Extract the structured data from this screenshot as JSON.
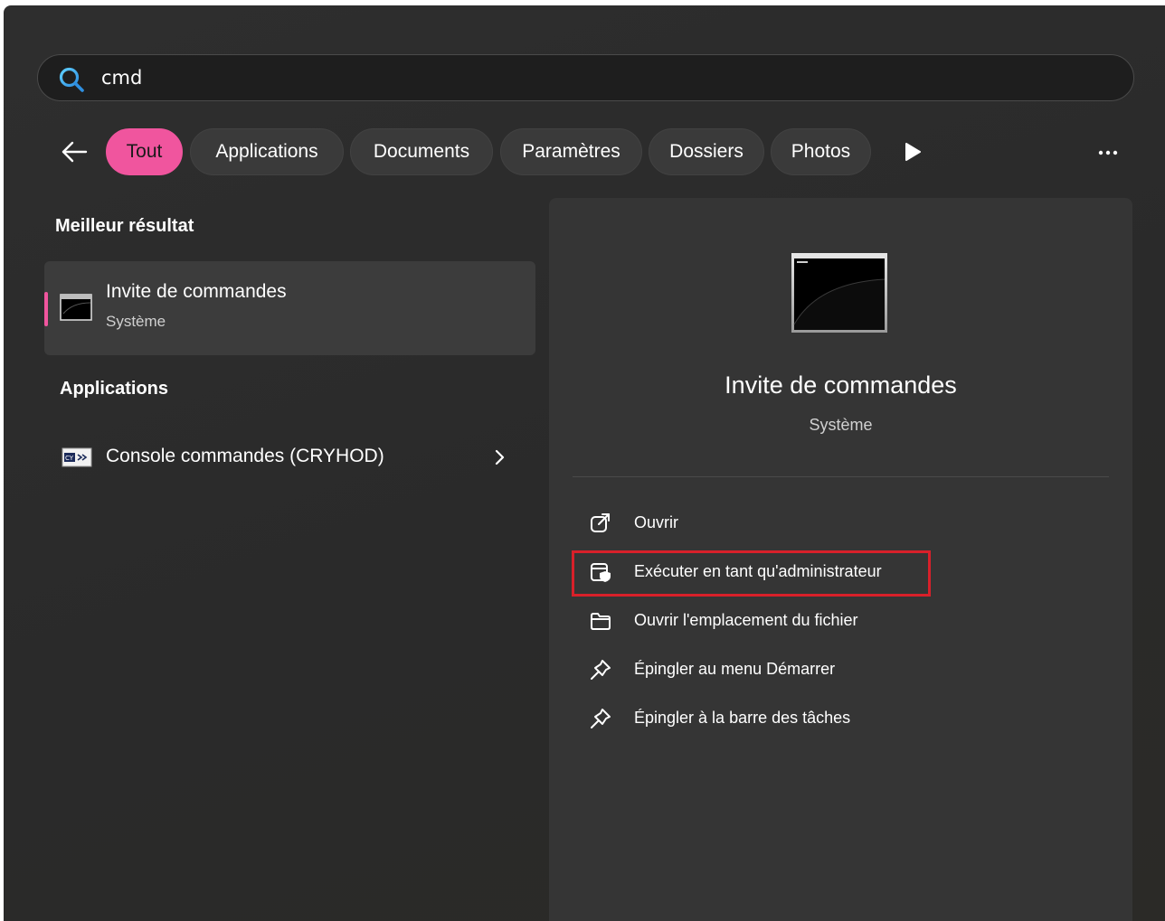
{
  "search": {
    "value": "cmd",
    "icon": "search-icon",
    "accent_color": "#4fc3f7"
  },
  "filters": {
    "back_icon": "arrow-left-icon",
    "chips": [
      "Tout",
      "Applications",
      "Documents",
      "Paramètres",
      "Dossiers",
      "Photos"
    ],
    "active_index": 0,
    "active_color": "#f0559e",
    "play_icon": "play-icon",
    "more_icon": "more-horizontal-icon"
  },
  "best_result": {
    "heading": "Meilleur résultat",
    "title": "Invite de commandes",
    "subtitle": "Système",
    "icon": "command-prompt-icon"
  },
  "applications": {
    "heading": "Applications",
    "items": [
      {
        "label": "Console commandes (CRYHOD)",
        "icon": "cryhod-console-icon"
      }
    ]
  },
  "details": {
    "title": "Invite de commandes",
    "subtitle": "Système",
    "actions": [
      {
        "label": "Ouvrir",
        "icon": "open-external-icon"
      },
      {
        "label": "Exécuter en tant qu'administrateur",
        "icon": "shield-window-icon"
      },
      {
        "label": "Ouvrir l'emplacement du fichier",
        "icon": "folder-icon"
      },
      {
        "label": "Épingler au menu Démarrer",
        "icon": "pin-icon"
      },
      {
        "label": "Épingler à la barre des tâches",
        "icon": "pin-icon"
      }
    ],
    "highlight_color": "#d8202a"
  }
}
